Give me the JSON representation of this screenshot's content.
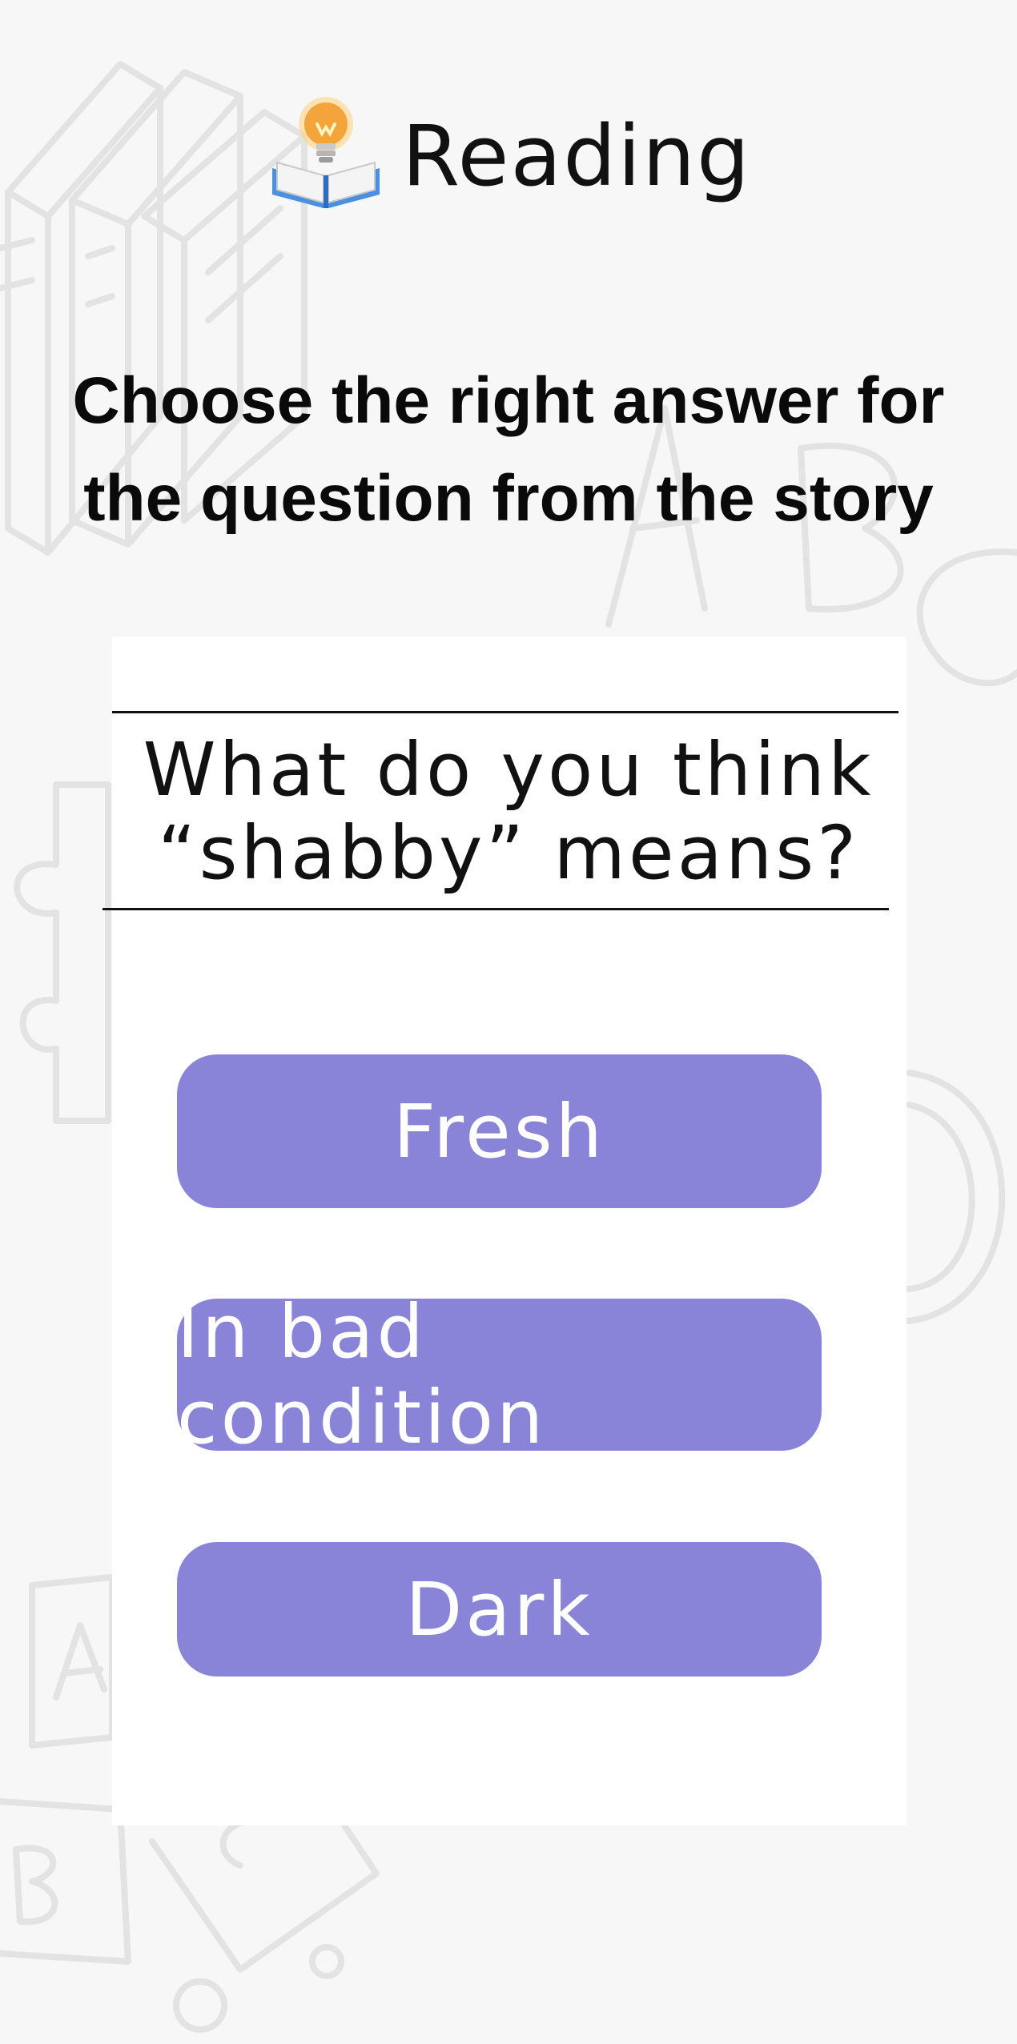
{
  "header": {
    "title": "Reading",
    "icon": "lightbulb-book-icon"
  },
  "instruction": "Choose the right answer for the question from the story",
  "question": {
    "line1": "What do you think",
    "line2": "“shabby” means?"
  },
  "answers": [
    {
      "label": "Fresh"
    },
    {
      "label": "In bad condition"
    },
    {
      "label": "Dark"
    }
  ],
  "colors": {
    "background": "#f7f7f7",
    "card": "#ffffff",
    "answer_button": "#8a84d8",
    "answer_text": "#ffffff",
    "doodles": "#e4e4e4"
  }
}
